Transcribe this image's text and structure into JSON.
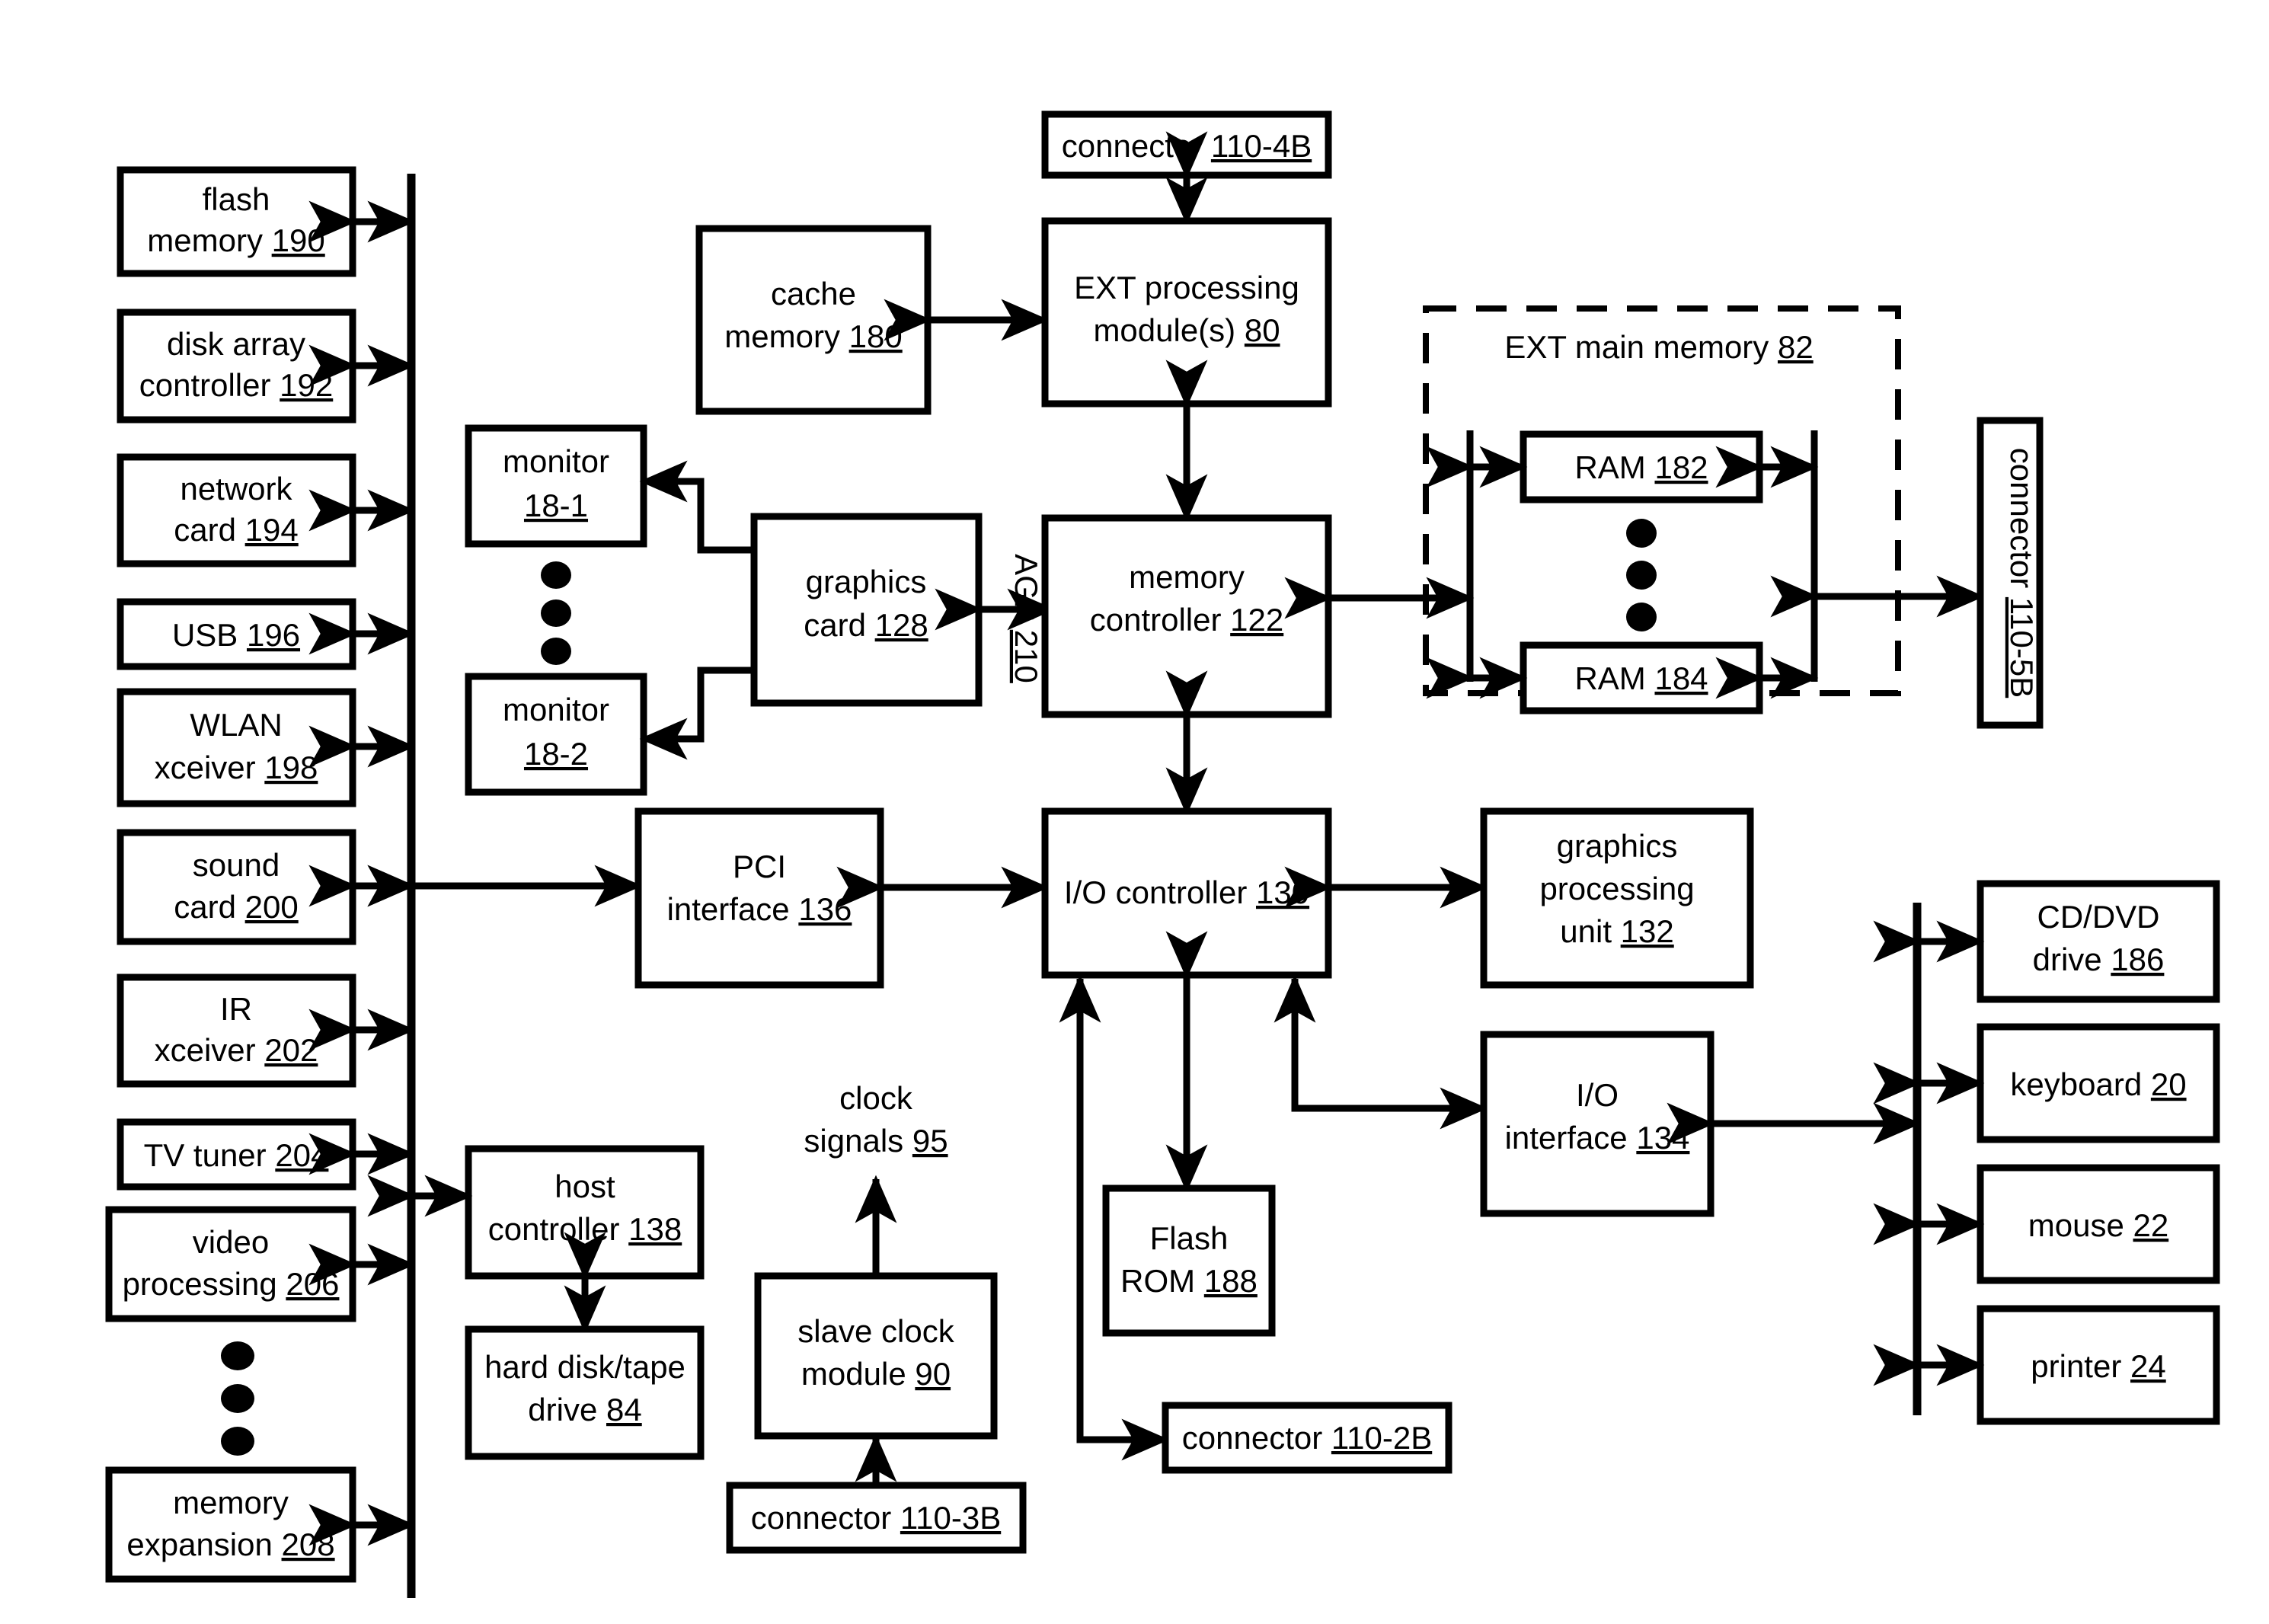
{
  "figure": {
    "type": "patent-block-diagram",
    "background": "#ffffff",
    "line_color": "#000000"
  },
  "left_peripherals": [
    {
      "id": "flash-memory-190",
      "line1": "flash",
      "line2": "memory",
      "ref": "190"
    },
    {
      "id": "disk-array-192",
      "line1": "disk array",
      "line2": "controller",
      "ref": "192"
    },
    {
      "id": "network-card-194",
      "line1": "network",
      "line2": "card",
      "ref": "194"
    },
    {
      "id": "usb-196",
      "line1": "",
      "line2": "USB",
      "ref": "196"
    },
    {
      "id": "wlan-xceiver-198",
      "line1": "WLAN",
      "line2": "xceiver",
      "ref": "198"
    },
    {
      "id": "sound-card-200",
      "line1": "sound",
      "line2": "card",
      "ref": "200"
    },
    {
      "id": "ir-xceiver-202",
      "line1": "IR",
      "line2": "xceiver",
      "ref": "202"
    },
    {
      "id": "tv-tuner-204",
      "line1": "",
      "line2": "TV tuner",
      "ref": "204"
    },
    {
      "id": "video-processing-206",
      "line1": "video",
      "line2": "processing",
      "ref": "206"
    },
    {
      "id": "memory-expansion-208",
      "line1": "memory",
      "line2": "expansion",
      "ref": "208"
    }
  ],
  "right_peripherals": [
    {
      "id": "cd-dvd-drive-186",
      "line1": "CD/DVD",
      "line2": "drive",
      "ref": "186"
    },
    {
      "id": "keyboard-20",
      "line1": "",
      "line2": "keyboard",
      "ref": "20"
    },
    {
      "id": "mouse-22",
      "line1": "",
      "line2": "mouse",
      "ref": "22"
    },
    {
      "id": "printer-24",
      "line1": "",
      "line2": "printer",
      "ref": "24"
    }
  ],
  "monitors": [
    {
      "id": "monitor-18-1",
      "line1": "monitor",
      "line2": "",
      "ref": "18-1"
    },
    {
      "id": "monitor-18-2",
      "line1": "monitor",
      "line2": "",
      "ref": "18-2"
    }
  ],
  "ram_modules": [
    {
      "id": "ram-182",
      "line2": "RAM",
      "ref": "182"
    },
    {
      "id": "ram-184",
      "line2": "RAM",
      "ref": "184"
    }
  ],
  "core_blocks": {
    "connector_110_4b": {
      "line2": "connector",
      "ref": "110-4B"
    },
    "cache_memory_180": {
      "line1": "cache",
      "line2": "memory",
      "ref": "180"
    },
    "ext_processing_80": {
      "line1": "EXT processing",
      "line2": "module(s)",
      "ref": "80"
    },
    "graphics_card_128": {
      "line1": "graphics",
      "line2": "card",
      "ref": "128"
    },
    "memory_controller_122": {
      "line1": "memory",
      "line2": "controller",
      "ref": "122"
    },
    "pci_interface_136": {
      "line1": "PCI",
      "line2": "interface",
      "ref": "136"
    },
    "io_controller_130": {
      "line2": "I/O controller",
      "ref": "130"
    },
    "gpu_132": {
      "line1": "graphics",
      "line1b": "processing",
      "line2": "unit",
      "ref": "132"
    },
    "io_interface_134": {
      "line1": "I/O",
      "line2": "interface",
      "ref": "134"
    },
    "host_controller_138": {
      "line1": "host",
      "line2": "controller",
      "ref": "138"
    },
    "hard_disk_tape_84": {
      "line1": "hard disk/tape",
      "line2": "drive",
      "ref": "84"
    },
    "slave_clock_90": {
      "line1": "slave clock",
      "line2": "module",
      "ref": "90"
    },
    "flash_rom_188": {
      "line1": "Flash",
      "line2": "ROM",
      "ref": "188"
    },
    "connector_110_3b": {
      "line2": "connector",
      "ref": "110-3B"
    },
    "connector_110_2b": {
      "line2": "connector",
      "ref": "110-2B"
    },
    "connector_110_5b": {
      "line2": "connector",
      "ref": "110-5B",
      "orientation": "vertical"
    }
  },
  "free_labels": {
    "ext_main_memory_82": {
      "line2": "EXT main memory",
      "ref": "82"
    },
    "clock_signals_95": {
      "line1": "clock",
      "line2": "signals",
      "ref": "95"
    },
    "agp_210": {
      "line2": "AGP",
      "ref": "210",
      "orientation": "vertical"
    }
  }
}
